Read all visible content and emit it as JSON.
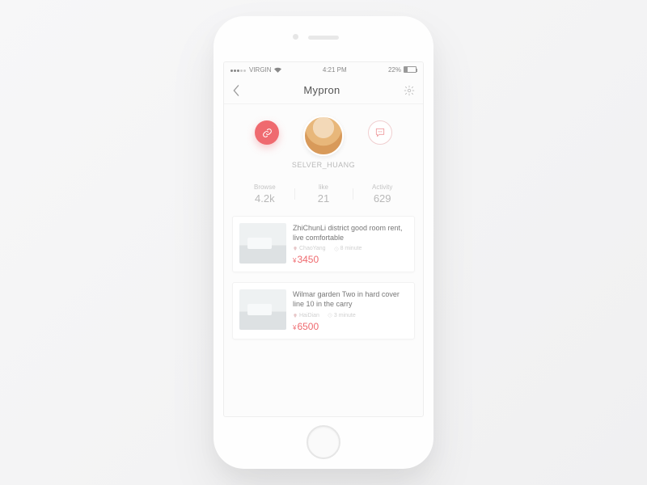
{
  "status": {
    "carrier": "VIRGIN",
    "time": "4:21 PM",
    "battery": "22%"
  },
  "nav": {
    "title": "Mypron"
  },
  "profile": {
    "username": "SELVER_HUANG"
  },
  "stats": [
    {
      "label": "Browse",
      "value": "4.2k"
    },
    {
      "label": "like",
      "value": "21"
    },
    {
      "label": "Activity",
      "value": "629"
    }
  ],
  "listings": [
    {
      "title": "ZhiChunLi district good room rent, live comfortable",
      "location": "ChaoYang",
      "time": "8 minute",
      "currency": "¥",
      "price": "3450"
    },
    {
      "title": "Wilmar garden Two in hard cover line 10 in the carry",
      "location": "HaiDian",
      "time": "3 minute",
      "currency": "¥",
      "price": "6500"
    }
  ]
}
